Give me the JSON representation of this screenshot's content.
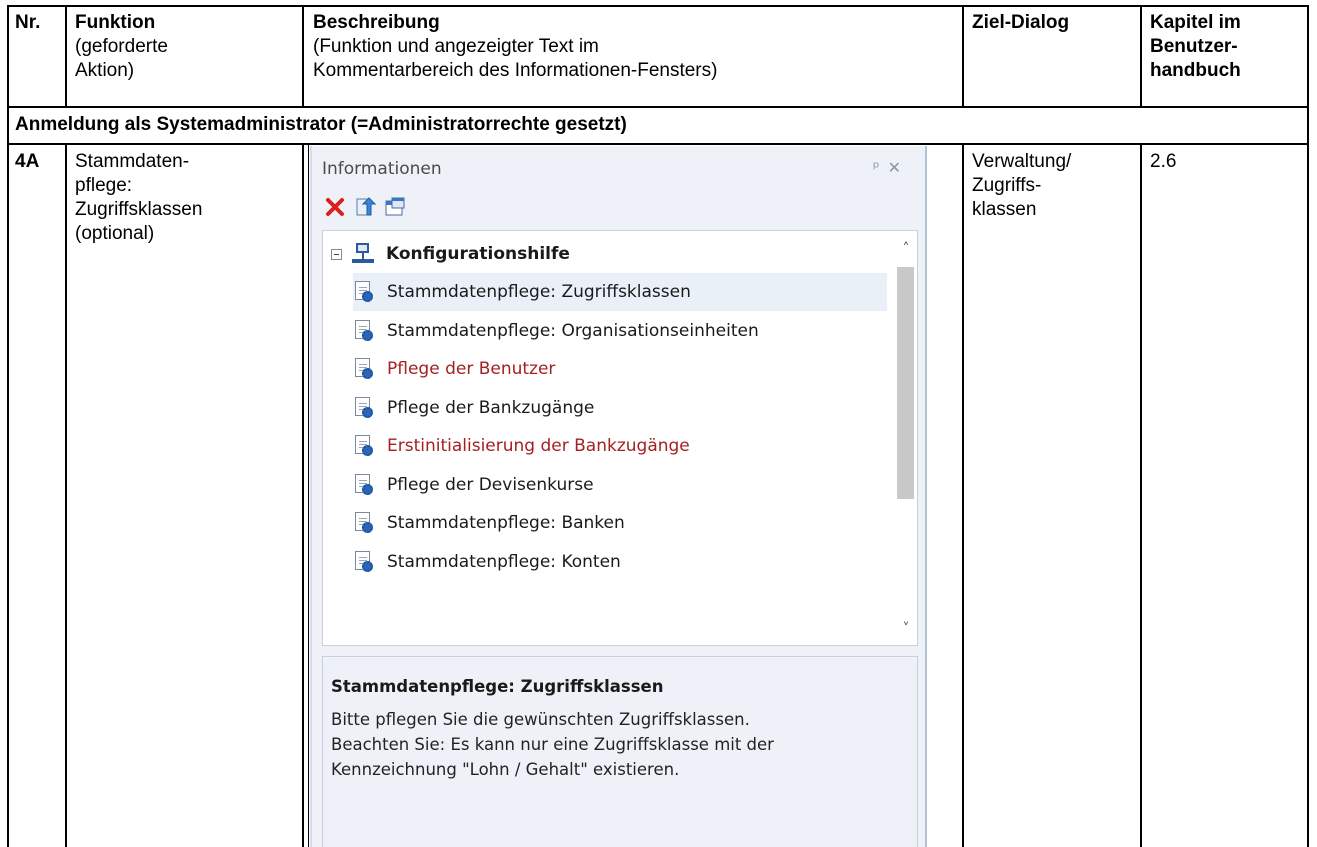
{
  "table": {
    "headers": {
      "nr": "Nr.",
      "funktion_title": "Funktion",
      "funktion_sub": "(geforderte\nAktion)",
      "beschreibung_title": "Beschreibung",
      "beschreibung_sub": "(Funktion und angezeigter Text im\nKommentarbereich des Informationen-Fensters)",
      "ziel": "Ziel-Dialog",
      "kapitel": "Kapitel im\nBenutzer-\nhandbuch"
    },
    "section_row": "Anmeldung als Systemadministrator (=Administratorrechte gesetzt)",
    "row": {
      "nr": "4A",
      "funktion": "Stammdaten-\npflege:\nZugriffsklassen\n(optional)",
      "ziel": "Verwaltung/\nZugriffs-\nklassen",
      "kapitel": "2.6"
    }
  },
  "panel": {
    "title": "Informationen",
    "pin_close": "ᵖ ✕",
    "tree_root": "Konfigurationshilfe",
    "items": [
      {
        "label": "Stammdatenpflege: Zugriffsklassen",
        "style": "selected"
      },
      {
        "label": "Stammdatenpflege: Organisationseinheiten",
        "style": "normal"
      },
      {
        "label": "Pflege der Benutzer",
        "style": "red"
      },
      {
        "label": "Pflege der Bankzugänge",
        "style": "normal"
      },
      {
        "label": "Erstinitialisierung der Bankzugänge",
        "style": "red"
      },
      {
        "label": "Pflege der Devisenkurse",
        "style": "normal"
      },
      {
        "label": "Stammdatenpflege: Banken",
        "style": "normal"
      },
      {
        "label": "Stammdatenpflege: Konten",
        "style": "normal"
      }
    ],
    "description_title": "Stammdatenpflege: Zugriffsklassen",
    "description_text": "Bitte pflegen Sie die gewünschten Zugriffsklassen.\nBeachten Sie: Es kann nur eine Zugriffsklasse mit der\nKennzeichnung \"Lohn / Gehalt\" existieren.",
    "icons": [
      "delete-icon",
      "move-up-icon",
      "window-icon"
    ],
    "colors": {
      "red_item": "#a42121",
      "panel_bg": "#eef2f8"
    }
  }
}
